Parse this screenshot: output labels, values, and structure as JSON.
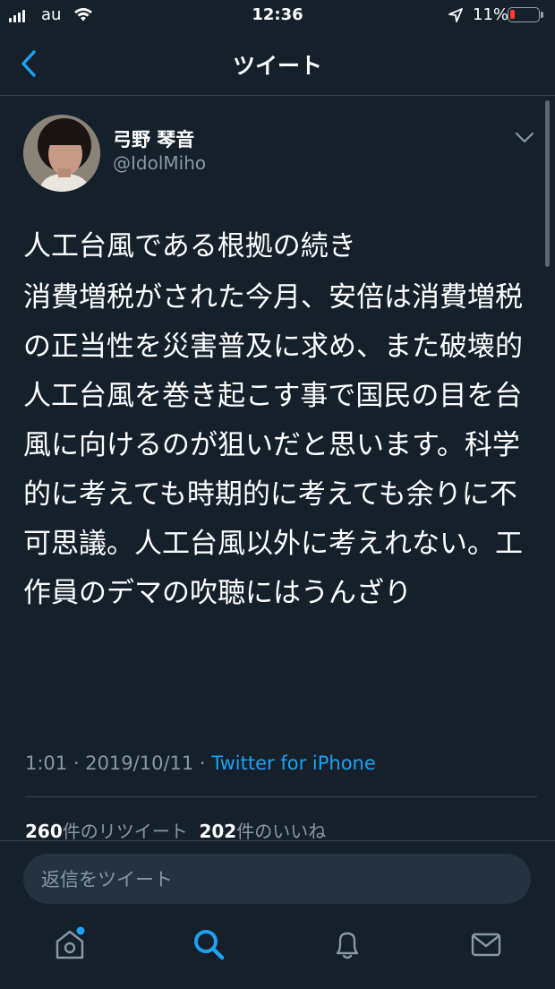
{
  "status_bar": {
    "carrier": "au",
    "time": "12:36",
    "battery": "11%"
  },
  "header": {
    "title": "ツイート"
  },
  "author": {
    "name": "弓野 琴音",
    "handle": "@IdolMiho"
  },
  "tweet": {
    "line1": "人工台風である根拠の続き",
    "body": "消費増税がされた今月、安倍は消費増税の正当性を災害普及に求め、また破壊的人工台風を巻き起こす事で国民の目を台風に向けるのが狙いだと思います。科学的に考えても時期的に考えても余りに不可思議。人工台風以外に考えれない。工作員のデマの吹聴にはうんざり"
  },
  "meta": {
    "time": "1:01",
    "date": "2019/10/11",
    "sep": " · ",
    "source": "Twitter for iPhone"
  },
  "stats": {
    "retweets": "260",
    "retweets_label": "件のリツイート",
    "likes": "202",
    "likes_label": "件のいいね"
  },
  "reply": {
    "placeholder": "返信をツイート"
  },
  "tabs": [
    "home-icon",
    "search-icon",
    "notifications-icon",
    "messages-icon"
  ],
  "colors": {
    "background": "#15202b",
    "accent": "#1da1f2",
    "secondary_text": "#8899a6"
  }
}
